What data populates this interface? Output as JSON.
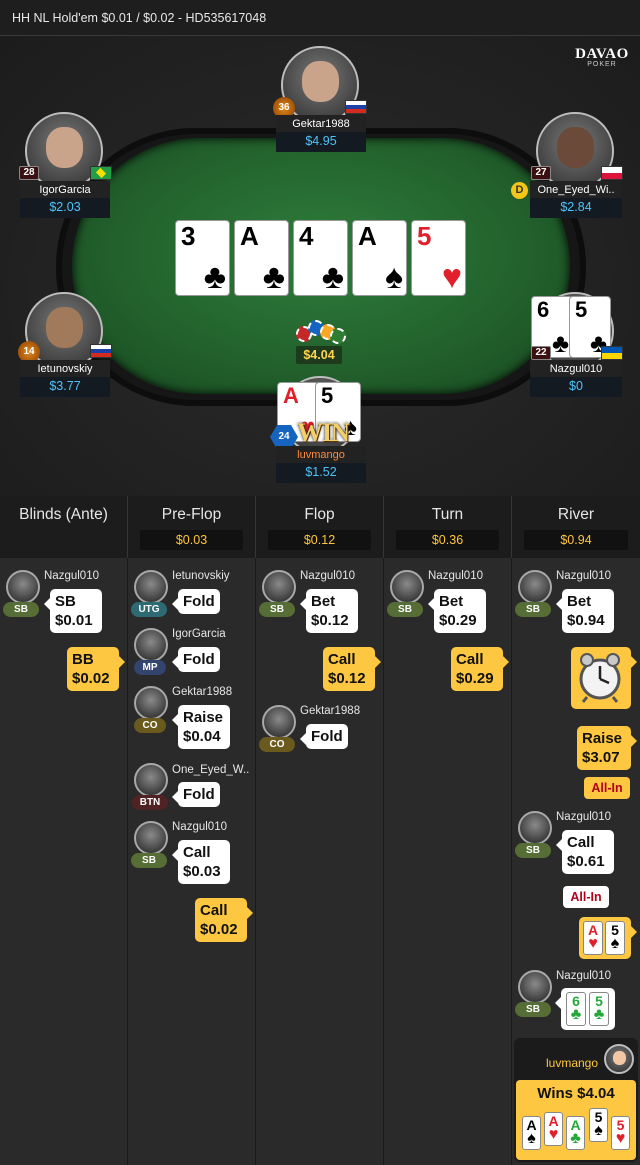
{
  "header": {
    "title": "HH NL Hold'em $0.01 / $0.02   - HD535617048"
  },
  "brand": {
    "line1": "DAVAO",
    "line2": "POKER"
  },
  "table": {
    "players": {
      "gektar": {
        "name": "Gektar1988",
        "stack": "$4.95",
        "level": "36",
        "flag": "ru"
      },
      "igor": {
        "name": "IgorGarcia",
        "stack": "$2.03",
        "level": "28",
        "flag": "br"
      },
      "one_eyed": {
        "name": "One_Eyed_Wi..",
        "stack": "$2.84",
        "level": "27",
        "flag": "pl"
      },
      "ietunovskiy": {
        "name": "Ietunovskiy",
        "stack": "$3.77",
        "level": "14",
        "flag": "ru"
      },
      "nazgul": {
        "name": "Nazgul010",
        "stack": "$0",
        "level": "22",
        "flag": "ua"
      },
      "luvmango": {
        "name": "luvmango",
        "stack": "$1.52",
        "level": "24"
      }
    },
    "board": [
      {
        "rank": "3",
        "suit": "♣"
      },
      {
        "rank": "A",
        "suit": "♣"
      },
      {
        "rank": "4",
        "suit": "♣"
      },
      {
        "rank": "A",
        "suit": "♠"
      },
      {
        "rank": "5",
        "suit": "♥"
      }
    ],
    "nazgul_cards": [
      {
        "rank": "6",
        "suit": "♣"
      },
      {
        "rank": "5",
        "suit": "♣"
      }
    ],
    "hero_cards": [
      {
        "rank": "A",
        "suit": "♥"
      },
      {
        "rank": "5",
        "suit": "♠"
      }
    ],
    "pot": "$4.04",
    "dealer": "D",
    "win_label": "WIN"
  },
  "streets": [
    {
      "title": "Blinds (Ante)",
      "pot": ""
    },
    {
      "title": "Pre-Flop",
      "pot": "$0.03"
    },
    {
      "title": "Flop",
      "pot": "$0.12"
    },
    {
      "title": "Turn",
      "pot": "$0.36"
    },
    {
      "title": "River",
      "pot": "$0.94"
    }
  ],
  "history": {
    "blinds": {
      "a1": {
        "player": "Nazgul010",
        "pos": "SB",
        "line1": "SB",
        "line2": "$0.01"
      },
      "a2": {
        "line1": "BB",
        "line2": "$0.02"
      }
    },
    "preflop": {
      "a1": {
        "player": "Ietunovskiy",
        "pos": "UTG",
        "line1": "Fold"
      },
      "a2": {
        "player": "IgorGarcia",
        "pos": "MP",
        "line1": "Fold"
      },
      "a3": {
        "player": "Gektar1988",
        "pos": "CO",
        "line1": "Raise",
        "line2": "$0.04"
      },
      "a4": {
        "player": "One_Eyed_W..",
        "pos": "BTN",
        "line1": "Fold"
      },
      "a5": {
        "player": "Nazgul010",
        "pos": "SB",
        "line1": "Call",
        "line2": "$0.03"
      },
      "a6": {
        "line1": "Call",
        "line2": "$0.02"
      }
    },
    "flop": {
      "a1": {
        "player": "Nazgul010",
        "pos": "SB",
        "line1": "Bet",
        "line2": "$0.12"
      },
      "a2": {
        "line1": "Call",
        "line2": "$0.12"
      },
      "a3": {
        "player": "Gektar1988",
        "pos": "CO",
        "line1": "Fold"
      }
    },
    "turn": {
      "a1": {
        "player": "Nazgul010",
        "pos": "SB",
        "line1": "Bet",
        "line2": "$0.29"
      },
      "a2": {
        "line1": "Call",
        "line2": "$0.29"
      }
    },
    "river": {
      "a1": {
        "player": "Nazgul010",
        "pos": "SB",
        "line1": "Bet",
        "line2": "$0.94"
      },
      "a2": {
        "icon": "alarm-clock-icon"
      },
      "a3": {
        "line1": "Raise",
        "line2": "$3.07",
        "tag": "All-In"
      },
      "a4": {
        "player": "Nazgul010",
        "pos": "SB",
        "line1": "Call",
        "line2": "$0.61",
        "tag": "All-In"
      },
      "a5": {
        "cards": [
          {
            "rank": "A",
            "suit": "♥"
          },
          {
            "rank": "5",
            "suit": "♠"
          }
        ]
      },
      "a6": {
        "player": "Nazgul010",
        "pos": "SB",
        "cards": [
          {
            "rank": "6",
            "suit": "♣"
          },
          {
            "rank": "5",
            "suit": "♣"
          }
        ]
      },
      "winner": {
        "player": "luvmango",
        "text": "Wins $4.04",
        "cards": [
          {
            "rank": "A",
            "suit": "♠"
          },
          {
            "rank": "A",
            "suit": "♥"
          },
          {
            "rank": "A",
            "suit": "♣"
          },
          {
            "rank": "5",
            "suit": "♠"
          },
          {
            "rank": "5",
            "suit": "♥"
          }
        ]
      }
    }
  },
  "colors": {
    "accent": "#fdc741",
    "stack": "#4fc3f7",
    "felt": "#23622d"
  }
}
